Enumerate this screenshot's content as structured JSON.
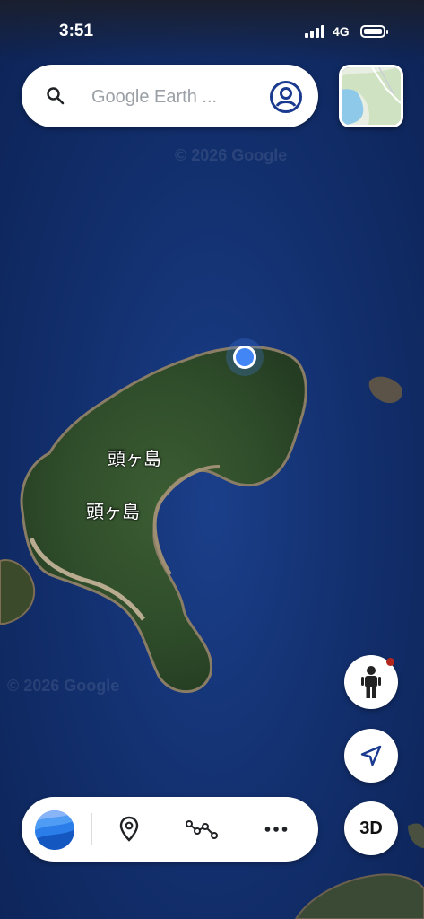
{
  "status_bar": {
    "time": "3:51",
    "network": "4G"
  },
  "search": {
    "placeholder": "Google Earth ..."
  },
  "map": {
    "labels": [
      "頭ヶ島",
      "頭ヶ島"
    ],
    "watermarks": [
      "© 2026 Google",
      "© 2026 Google"
    ]
  },
  "controls": {
    "three_d_label": "3D"
  },
  "colors": {
    "accent": "#4285f4",
    "dark_blue": "#1a3a8f",
    "sea": "#13306f"
  },
  "icons": [
    "search-icon",
    "account-icon",
    "pegman-icon",
    "navigation-arrow-icon",
    "earth-logo-icon",
    "pin-icon",
    "path-icon",
    "more-icon"
  ]
}
